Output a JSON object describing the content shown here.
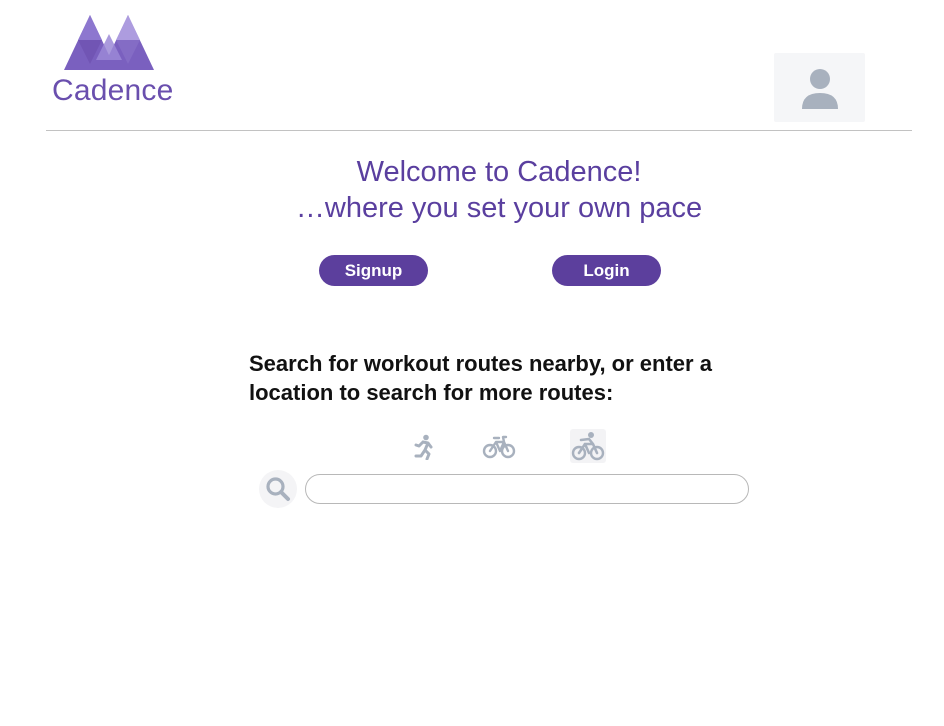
{
  "brand": {
    "name": "Cadence",
    "color": "#6a4fae"
  },
  "welcome": {
    "line1": "Welcome to Cadence!",
    "line2": "…where you set your own pace"
  },
  "auth": {
    "signup_label": "Signup",
    "login_label": "Login"
  },
  "search": {
    "prompt": "Search for workout routes nearby, or enter a location to search for more routes:",
    "value": "",
    "placeholder": ""
  },
  "activities": [
    {
      "icon": "running-icon"
    },
    {
      "icon": "bicycle-icon"
    },
    {
      "icon": "cyclist-icon"
    }
  ],
  "colors": {
    "accent": "#5c3f9d",
    "icon_gray": "#a8b1be"
  }
}
